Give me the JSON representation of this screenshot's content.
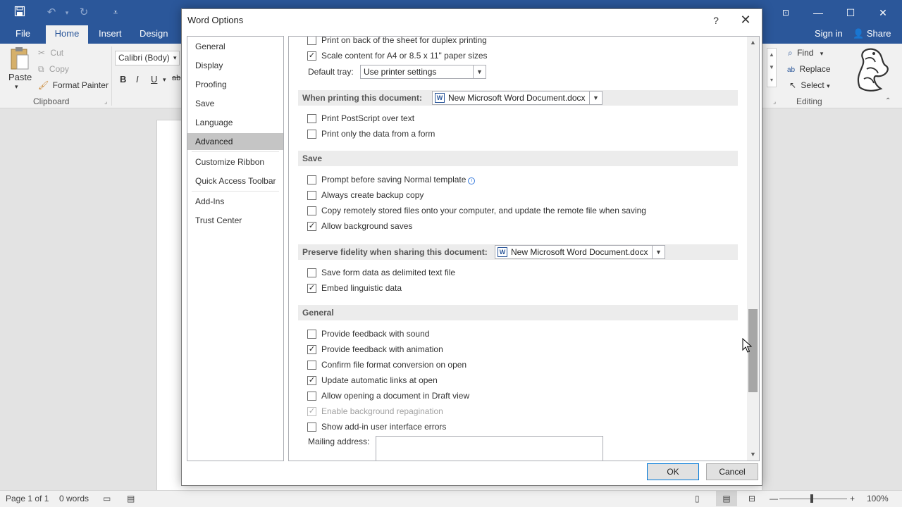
{
  "window": {
    "qat": {
      "save_icon": "save-icon",
      "undo_icon": "undo-icon",
      "redo_icon": "redo-icon",
      "customize_icon": "customize-qat-icon"
    },
    "controls": {
      "ribbon_display": "ribbon-display-icon",
      "minimize": "—",
      "maximize": "☐",
      "close": "✕"
    }
  },
  "ribbon": {
    "tabs": [
      "File",
      "Home",
      "Insert",
      "Design"
    ],
    "active_tab": "Home",
    "sign_in": "Sign in",
    "share": "Share",
    "clipboard": {
      "paste": "Paste",
      "cut": "Cut",
      "copy": "Copy",
      "format_painter": "Format Painter",
      "group": "Clipboard"
    },
    "font": {
      "name": "Calibri (Body)",
      "bold": "B",
      "italic": "I",
      "underline": "U",
      "strike": "ab"
    },
    "editing": {
      "find": "Find",
      "replace": "Replace",
      "select": "Select",
      "group": "Editing"
    }
  },
  "status": {
    "page": "Page 1 of 1",
    "words": "0 words",
    "zoom": "100%"
  },
  "dialog": {
    "title": "Word Options",
    "help": "?",
    "close": "✕",
    "nav": [
      {
        "label": "General",
        "active": false
      },
      {
        "label": "Display",
        "active": false
      },
      {
        "label": "Proofing",
        "active": false
      },
      {
        "label": "Save",
        "active": false
      },
      {
        "label": "Language",
        "active": false
      },
      {
        "label": "Advanced",
        "active": true
      },
      {
        "label": "Customize Ribbon",
        "active": false
      },
      {
        "label": "Quick Access Toolbar",
        "active": false
      },
      {
        "label": "Add-Ins",
        "active": false
      },
      {
        "label": "Trust Center",
        "active": false
      }
    ],
    "print_options": [
      {
        "label": "Print on back of the sheet for duplex printing",
        "checked": false
      },
      {
        "label": "Scale content for A4 or 8.5 x 11\" paper sizes",
        "checked": true
      }
    ],
    "default_tray_label": "Default tray:",
    "default_tray_value": "Use printer settings",
    "when_printing": {
      "header": "When printing this document:",
      "document": "New Microsoft Word Document.docx",
      "options": [
        {
          "label": "Print PostScript over text",
          "checked": false
        },
        {
          "label": "Print only the data from a form",
          "checked": false
        }
      ]
    },
    "save": {
      "header": "Save",
      "options": [
        {
          "label": "Prompt before saving Normal template",
          "checked": false
        },
        {
          "label": "Always create backup copy",
          "checked": false
        },
        {
          "label": "Copy remotely stored files onto your computer, and update the remote file when saving",
          "checked": false
        },
        {
          "label": "Allow background saves",
          "checked": true
        }
      ]
    },
    "preserve": {
      "header": "Preserve fidelity when sharing this document:",
      "document": "New Microsoft Word Document.docx",
      "options": [
        {
          "label": "Save form data as delimited text file",
          "checked": false
        },
        {
          "label": "Embed linguistic data",
          "checked": true
        }
      ]
    },
    "general": {
      "header": "General",
      "options": [
        {
          "label": "Provide feedback with sound",
          "checked": false,
          "disabled": false
        },
        {
          "label": "Provide feedback with animation",
          "checked": true,
          "disabled": false
        },
        {
          "label": "Confirm file format conversion on open",
          "checked": false,
          "disabled": false
        },
        {
          "label": "Update automatic links at open",
          "checked": true,
          "disabled": false
        },
        {
          "label": "Allow opening a document in Draft view",
          "checked": false,
          "disabled": false
        },
        {
          "label": "Enable background repagination",
          "checked": true,
          "disabled": true
        },
        {
          "label": "Show add-in user interface errors",
          "checked": false,
          "disabled": false
        }
      ]
    },
    "mailing_address_label": "Mailing address:",
    "mailing_address_value": "",
    "ok": "OK",
    "cancel": "Cancel"
  }
}
